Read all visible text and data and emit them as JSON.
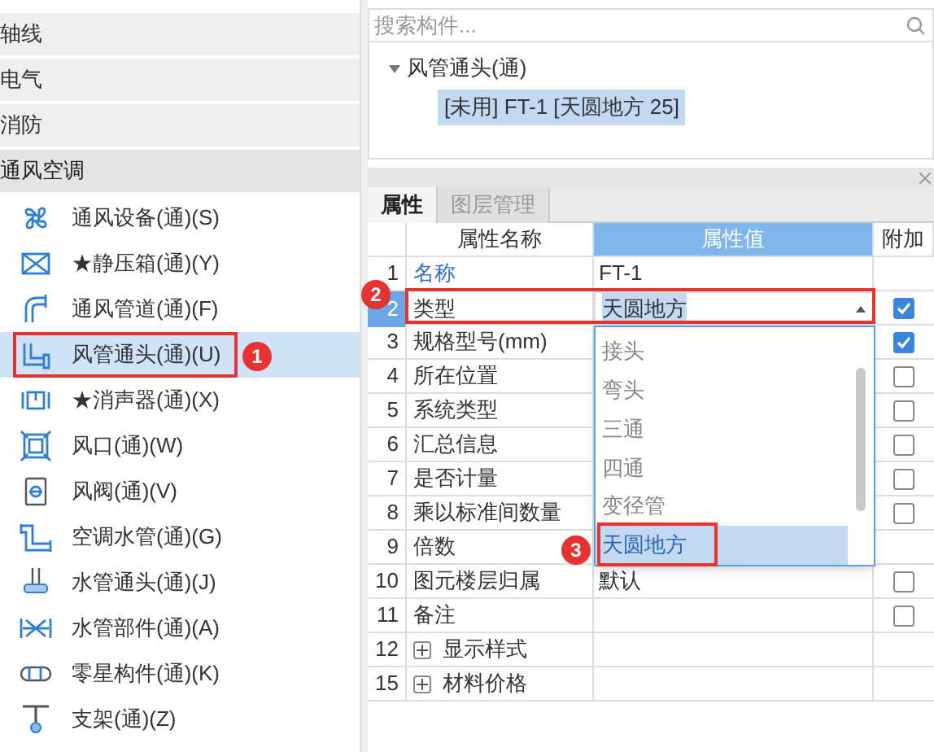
{
  "categories": [
    {
      "label": "轴线",
      "expanded": false
    },
    {
      "label": "电气",
      "expanded": false
    },
    {
      "label": "消防",
      "expanded": false
    },
    {
      "label": "通风空调",
      "expanded": true
    }
  ],
  "items": [
    {
      "label": "通风设备(通)(S)",
      "selected": false
    },
    {
      "label": "★静压箱(通)(Y)",
      "selected": false
    },
    {
      "label": "通风管道(通)(F)",
      "selected": false
    },
    {
      "label": "风管通头(通)(U)",
      "selected": true
    },
    {
      "label": "★消声器(通)(X)",
      "selected": false
    },
    {
      "label": "风口(通)(W)",
      "selected": false
    },
    {
      "label": "风阀(通)(V)",
      "selected": false
    },
    {
      "label": "空调水管(通)(G)",
      "selected": false
    },
    {
      "label": "水管通头(通)(J)",
      "selected": false
    },
    {
      "label": "水管部件(通)(A)",
      "selected": false
    },
    {
      "label": "零星构件(通)(K)",
      "selected": false
    },
    {
      "label": "支架(通)(Z)",
      "selected": false
    }
  ],
  "search": {
    "placeholder": "搜索构件..."
  },
  "tree": {
    "label": "风管通头(通)",
    "expanded": true,
    "children": [
      {
        "label": "[未用] FT-1 [天圆地方 25]",
        "selected": true
      }
    ]
  },
  "tabs": [
    {
      "label": "属性",
      "selected": true
    },
    {
      "label": "图层管理",
      "selected": false
    }
  ],
  "table": {
    "columns": [
      "属性名称",
      "属性值",
      "附加"
    ],
    "rows": [
      {
        "num": "1",
        "name": "名称",
        "value": "FT-1",
        "kind": "link",
        "selected": false
      },
      {
        "num": "2",
        "name": "类型",
        "value": "天圆地方",
        "kind": "dropdown",
        "selected": true,
        "checked": true
      },
      {
        "num": "3",
        "name": "规格型号(mm)",
        "kind": "plain",
        "selected": false,
        "checked": true
      },
      {
        "num": "4",
        "name": "所在位置",
        "kind": "plain",
        "selected": false,
        "checked": false
      },
      {
        "num": "5",
        "name": "系统类型",
        "kind": "plain",
        "selected": false,
        "checked": false
      },
      {
        "num": "6",
        "name": "汇总信息",
        "kind": "plain",
        "selected": false,
        "checked": false
      },
      {
        "num": "7",
        "name": "是否计量",
        "kind": "plain",
        "selected": false,
        "checked": false
      },
      {
        "num": "8",
        "name": "乘以标准间数量",
        "kind": "plain",
        "selected": false,
        "checked": false
      },
      {
        "num": "9",
        "name": "倍数",
        "kind": "plain",
        "selected": false
      },
      {
        "num": "10",
        "name": "图元楼层归属",
        "value": "默认",
        "kind": "plain",
        "selected": false,
        "checked": false
      },
      {
        "num": "11",
        "name": "备注",
        "kind": "plain",
        "selected": false,
        "checked": false
      },
      {
        "num": "12",
        "name": "显示样式",
        "kind": "group",
        "selected": false,
        "expanded": false
      },
      {
        "num": "15",
        "name": "材料价格",
        "kind": "group",
        "selected": false,
        "expanded": false
      }
    ]
  },
  "dropdown_options": [
    {
      "label": "接头",
      "selected": false
    },
    {
      "label": "弯头",
      "selected": false
    },
    {
      "label": "三通",
      "selected": false
    },
    {
      "label": "四通",
      "selected": false
    },
    {
      "label": "变径管",
      "selected": false
    },
    {
      "label": "天圆地方",
      "selected": true
    }
  ],
  "callouts": [
    "1",
    "2",
    "3"
  ]
}
